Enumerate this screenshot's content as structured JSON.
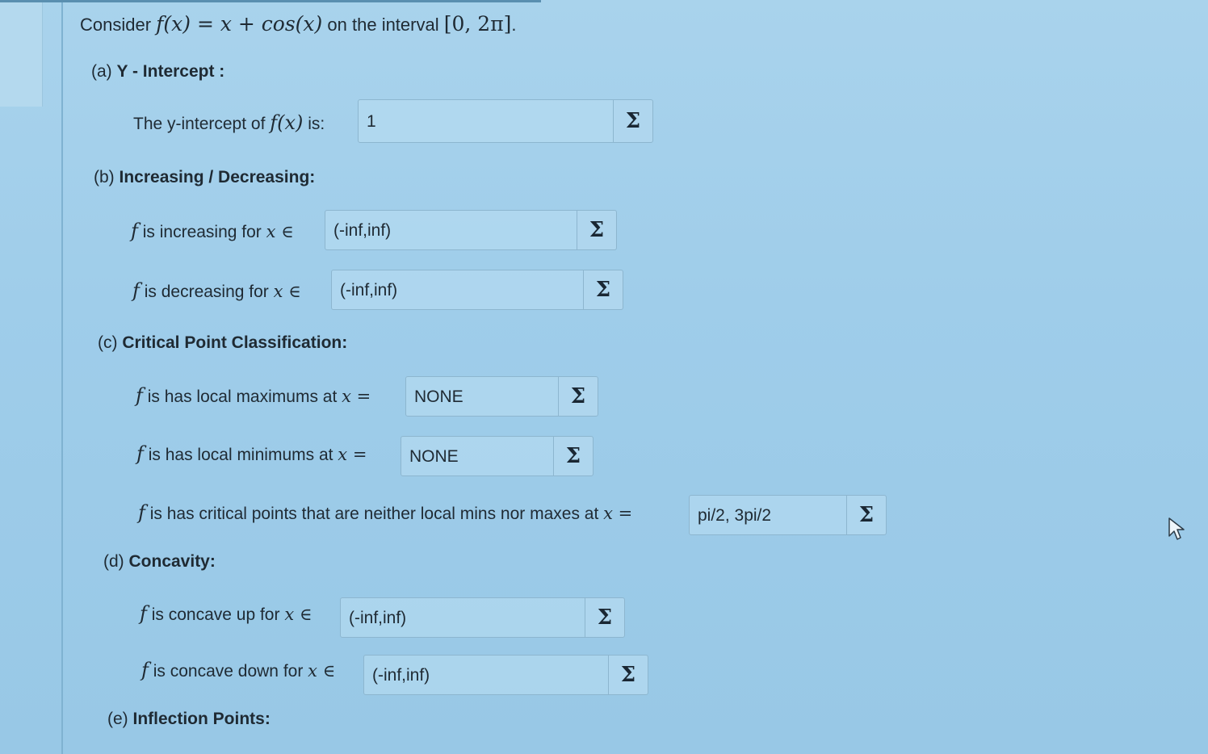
{
  "problem": {
    "prefix": "Consider ",
    "function_math": "f(x) = x + cos(x)",
    "middle": " on the interval ",
    "interval_math": "[0, 2π]",
    "suffix": "."
  },
  "part_a": {
    "letter": "(a) ",
    "title": "Y - Intercept :",
    "question_prefix": "The y-intercept of ",
    "question_math": "f(x)",
    "question_suffix": " is:",
    "answer": "1"
  },
  "part_b": {
    "letter": "(b) ",
    "title": "Increasing / Decreasing:",
    "increasing": {
      "f": "f",
      "text": " is increasing for ",
      "math": "x ∈",
      "answer": "(-inf,inf)"
    },
    "decreasing": {
      "f": "f",
      "text": " is decreasing for ",
      "math": "x ∈",
      "answer": "(-inf,inf)"
    }
  },
  "part_c": {
    "letter": "(c) ",
    "title": "Critical Point Classification:",
    "maxima": {
      "f": "f",
      "text": " is has local maximums at ",
      "math": "x =",
      "answer": "NONE"
    },
    "minima": {
      "f": "f",
      "text": " is has local minimums at ",
      "math": "x =",
      "answer": "NONE"
    },
    "neither": {
      "f": "f",
      "text": " is has critical points that are neither local mins nor maxes at ",
      "math": "x =",
      "answer": "pi/2, 3pi/2"
    }
  },
  "part_d": {
    "letter": "(d) ",
    "title": "Concavity:",
    "up": {
      "f": "f",
      "text": " is concave up for ",
      "math": "x ∈",
      "answer": "(-inf,inf)"
    },
    "down": {
      "f": "f",
      "text": " is concave down for ",
      "math": "x ∈",
      "answer": "(-inf,inf)"
    }
  },
  "part_e": {
    "letter": "(e) ",
    "title": "Inflection Points:"
  },
  "icons": {
    "sigma": "Σ",
    "sigma_name": "sigma-icon",
    "cursor_name": "mouse-pointer-icon"
  },
  "colors": {
    "background": "#a9d3ec",
    "field_border": "#8db6cf",
    "text": "#1f2a33"
  }
}
